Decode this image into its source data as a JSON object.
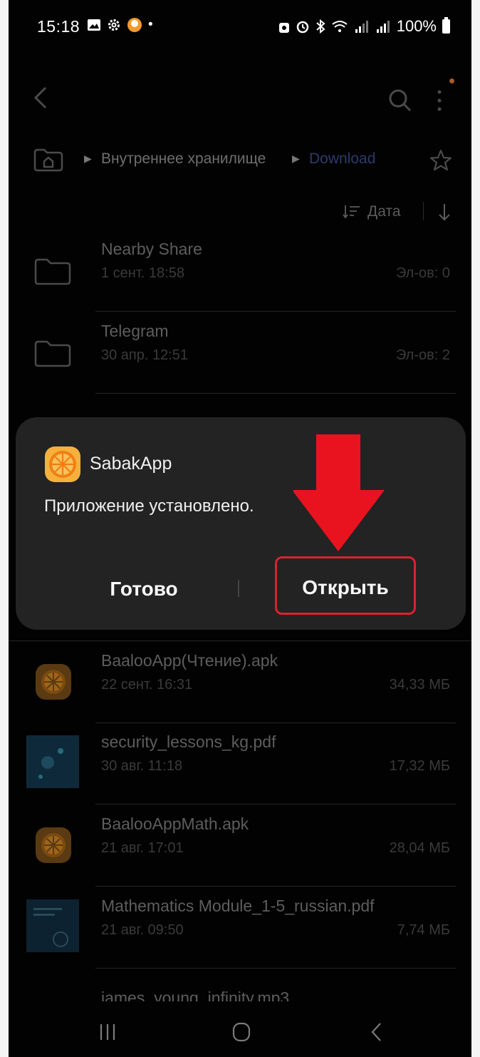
{
  "status_bar": {
    "time": "15:18",
    "battery": "100%"
  },
  "breadcrumb": {
    "items": [
      "Внутреннее хранилище",
      "Download"
    ]
  },
  "sort": {
    "label": "Дата"
  },
  "files_top": [
    {
      "name": "Nearby Share",
      "date": "1 сент. 18:58",
      "meta": "Эл-ов: 0",
      "type": "folder"
    },
    {
      "name": "Telegram",
      "date": "30 апр. 12:51",
      "meta": "Эл-ов: 2",
      "type": "folder"
    }
  ],
  "files_bottom": [
    {
      "name": "BaalooApp(Чтение).apk",
      "date": "22 сент. 16:31",
      "meta": "34,33 МБ",
      "type": "apk"
    },
    {
      "name": "security_lessons_kg.pdf",
      "date": "30 авг. 11:18",
      "meta": "17,32 МБ",
      "type": "pdf"
    },
    {
      "name": "BaalooAppMath.apk",
      "date": "21 авг. 17:01",
      "meta": "28,04 МБ",
      "type": "apk"
    },
    {
      "name": "Mathematics Module_1-5_russian.pdf",
      "date": "21 авг. 09:50",
      "meta": "7,74 МБ",
      "type": "pdf"
    },
    {
      "name": "james_young_infinity.mp3",
      "date": "",
      "meta": "",
      "type": "audio"
    }
  ],
  "dialog": {
    "app_name": "SabakApp",
    "message": "Приложение установлено.",
    "done_label": "Готово",
    "open_label": "Открыть"
  },
  "colors": {
    "background": "#020202",
    "dialog_bg": "#232323",
    "accent_red": "#e8131f",
    "download_crumb": "#2c3b6a",
    "app_orange": "#f0a030"
  }
}
